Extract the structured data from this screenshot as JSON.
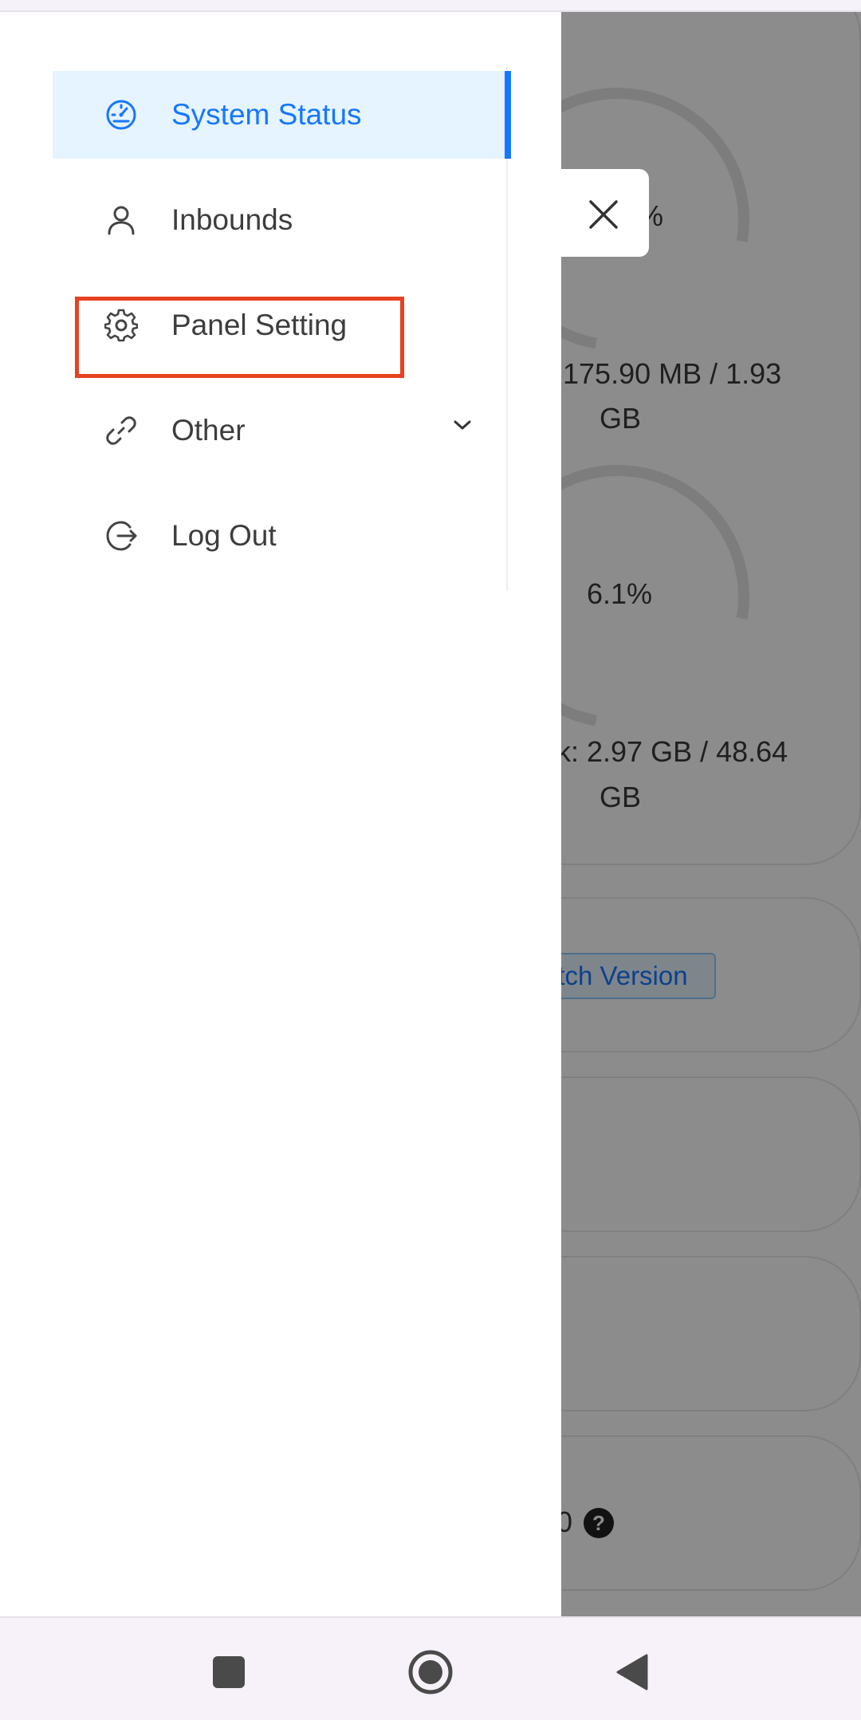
{
  "background": {
    "memory_text_line1": "175.90 MB / 1.93",
    "memory_text_line2": "GB",
    "cpu_partial": "%",
    "swap_percent": "6.1%",
    "disk_text_line1": "k: 2.97 GB / 48.64",
    "disk_text_line2": "GB",
    "switch_version_label": "itch Version",
    "bottom_value": "0",
    "help_glyph": "?"
  },
  "drawer": {
    "items": [
      {
        "label": "System Status",
        "icon": "dashboard-icon",
        "selected": true
      },
      {
        "label": "Inbounds",
        "icon": "user-icon",
        "selected": false
      },
      {
        "label": "Panel Setting",
        "icon": "gear-icon",
        "selected": false,
        "highlighted": true
      },
      {
        "label": "Other",
        "icon": "link-icon",
        "selected": false,
        "expandable": true
      },
      {
        "label": "Log Out",
        "icon": "logout-icon",
        "selected": false
      }
    ]
  },
  "colors": {
    "accent": "#1677ff",
    "selected_bg": "#e6f4ff",
    "highlight": "#e8411f",
    "overlay": "rgba(0,0,0,0.45)"
  },
  "nav": {
    "buttons": [
      "recents-button",
      "home-button",
      "back-button"
    ]
  }
}
